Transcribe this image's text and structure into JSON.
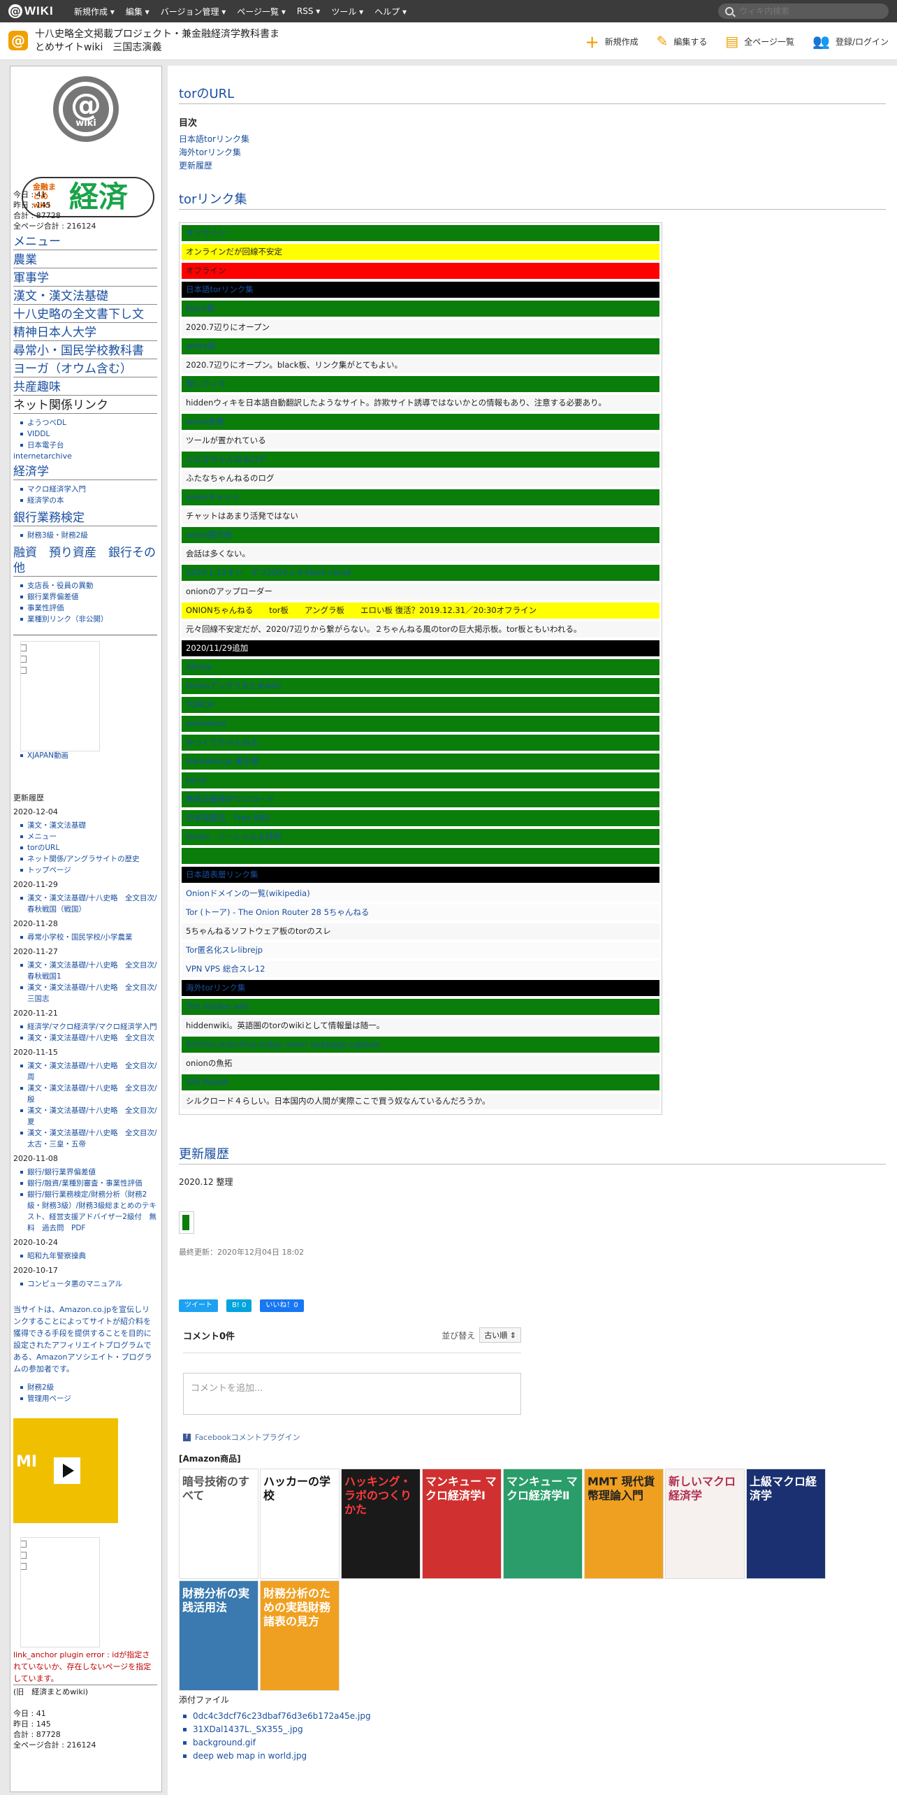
{
  "topbar": {
    "logo": "WIKI",
    "menus": [
      "新規作成 ▾",
      "編集 ▾",
      "バージョン管理 ▾",
      "ページ一覧 ▾",
      "RSS ▾",
      "ツール ▾",
      "ヘルプ ▾"
    ],
    "search_placeholder": "ウィキ内検索"
  },
  "header": {
    "site_title": "十八史略全文掲載プロジェクト・兼金融経済学教科書まとめサイトwiki　三国志演義",
    "actions": [
      "新規作成",
      "編集する",
      "全ページ一覧",
      "登録/ログイン"
    ]
  },
  "sidebar": {
    "badge_text": "wiki",
    "banner_small": "金融まとめwiki",
    "banner_big": "経済",
    "counters": [
      "今日 : 41",
      "昨日 : 145",
      "合計 : 87728",
      "全ページ合計 : 216124"
    ],
    "menu": "メニュー",
    "nav1": [
      "農業",
      "軍事学",
      "漢文・漢文法基礎",
      "十八史略の全文書下し文",
      "精神日本人大学",
      "尋常小・国民学校教科書",
      "ヨーガ（オウム含む）",
      "共産趣味"
    ],
    "net_heading": "ネット関係リンク",
    "net_links": [
      "ようつべDL",
      "VIDDL",
      "日本電子台"
    ],
    "internetarchive": "internetarchive",
    "econ_heading": "経済学",
    "econ_links": [
      "マクロ経済学入門",
      "経済学の本"
    ],
    "bank_heading": "銀行業務検定",
    "bank_links": [
      "財務3級・財務2級"
    ],
    "finance_heading": "融資　預り資産　銀行その他",
    "finance_links": [
      "支店長・役員の異動",
      "銀行業界偏差値",
      "事業性評価",
      "業種別リンク（非公開）"
    ],
    "misc_links": [
      "",
      "",
      "",
      "XJAPAN動画"
    ],
    "updates_title": "更新履歴",
    "updates": [
      {
        "date": "2020-12-04",
        "items": [
          "漢文・漢文法基礎",
          "メニュー",
          "torのURL",
          "ネット関係/アングラサイトの歴史",
          "トップページ"
        ]
      },
      {
        "date": "2020-11-29",
        "items": [
          "漢文・漢文法基礎/十八史略　全文目次/春秋戦国（戦国）"
        ]
      },
      {
        "date": "2020-11-28",
        "items": [
          "尋常小学校・国民学校/小学農業"
        ]
      },
      {
        "date": "2020-11-27",
        "items": [
          "漢文・漢文法基礎/十八史略　全文目次/春秋戦国1",
          "漢文・漢文法基礎/十八史略　全文目次/三国志"
        ]
      },
      {
        "date": "2020-11-21",
        "items": [
          "経済学/マクロ経済学/マクロ経済学入門",
          "漢文・漢文法基礎/十八史略　全文目次"
        ]
      },
      {
        "date": "2020-11-15",
        "items": [
          "漢文・漢文法基礎/十八史略　全文目次/周",
          "漢文・漢文法基礎/十八史略　全文目次/殷",
          "漢文・漢文法基礎/十八史略　全文目次/夏",
          "漢文・漢文法基礎/十八史略　全文目次/太古・三皇・五帝"
        ]
      },
      {
        "date": "2020-11-08",
        "items": [
          "銀行/銀行業界偏差値",
          "銀行/融資/業種別審査・事業性評価",
          "銀行/銀行業務検定/財務分析（財務2級・財務3級）/財務3級総まとめのテキスト、経営支援アドバイザー2級付　無料　過去問　PDF"
        ]
      },
      {
        "date": "2020-10-24",
        "items": [
          "昭和九年警察操典"
        ]
      },
      {
        "date": "2020-10-17",
        "items": [
          "コンピュータ悪のマニュアル"
        ]
      }
    ],
    "amazon_note": "当サイトは、Amazon.co.jpを宣伝しリンクすることによってサイトが紹介料を獲得できる手段を提供することを目的に設定されたアフィリエイトプログラムである、Amazonアソシエイト・プログラムの参加者です。",
    "admin_links": [
      "財務2級",
      "管理用ページ"
    ],
    "video_label": "MI",
    "bottom_links": [
      "",
      "",
      ""
    ],
    "error_text": "link_anchor plugin error : idが指定されていないか、存在しないページを指定しています。",
    "old_name": "(旧　経済まとめwiki)",
    "counters2": [
      "今日 : 41",
      "昨日 : 145",
      "合計 : 87728",
      "全ページ合計 : 216124"
    ]
  },
  "main": {
    "page_title": "torのURL",
    "toc_title": "目次",
    "toc": [
      "日本語torリンク集",
      "海外torリンク集",
      "更新履歴"
    ],
    "section_links": "torリンク集",
    "rows": [
      {
        "cls": "online",
        "text": "オンライン"
      },
      {
        "cls": "unstable",
        "text": "オンラインだが回線不安定"
      },
      {
        "cls": "offline",
        "text": "オフライン"
      },
      {
        "cls": "black lnk",
        "text": "日本語torリンク集"
      },
      {
        "cls": "online",
        "text": "black板"
      },
      {
        "cls": "desc",
        "text": "2020.7辺りにオープン"
      },
      {
        "cls": "online",
        "text": "white板"
      },
      {
        "cls": "desc",
        "text": "2020.7辺りにオープン。black板、リンク集がとてもよい。"
      },
      {
        "cls": "online",
        "text": "隠しウィキ"
      },
      {
        "cls": "desc",
        "text": "hiddenウィキを日本語自動翻訳したようなサイト。詐欺サイト誘導ではないかとの情報もあり、注意する必要あり。"
      },
      {
        "cls": "online",
        "text": "onion倉庫"
      },
      {
        "cls": "desc",
        "text": "ツールが置かれている"
      },
      {
        "cls": "online",
        "text": "ふたなちゃんねるログ"
      },
      {
        "cls": "desc",
        "text": "ふたなちゃんねるのログ"
      },
      {
        "cls": "online",
        "text": "onionチャット"
      },
      {
        "cls": "desc",
        "text": "チャットはあまり活発ではない"
      },
      {
        "cls": "online",
        "text": "onion掲示板"
      },
      {
        "cls": "desc",
        "text": "会話は多くない。"
      },
      {
        "cls": "online",
        "text": "2020.1.12オン　オフ2020.1.4 black cloud"
      },
      {
        "cls": "desc",
        "text": "onionのアップローダー"
      },
      {
        "cls": "unstable",
        "text": "ONIONちゃんねる　　tor板　　アングラ板　　エロい板 復活？2019.12.31／20:30オフライン"
      },
      {
        "cls": "desc",
        "text": "元々回線不安定だが、2020/7辺りから繋がらない。２ちゃんねる風のtorの巨大掲示板。tor板ともいわれる。"
      },
      {
        "cls": "black",
        "text": "2020/11/29追加"
      },
      {
        "cls": "online",
        "text": "Ahmia"
      },
      {
        "cls": "online",
        "text": "Onionアングラまとめwiki"
      },
      {
        "cls": "online",
        "text": "TORCH"
      },
      {
        "cls": "online",
        "text": "onionland"
      },
      {
        "cls": "online",
        "text": "ゆっくりちゃんねる"
      },
      {
        "cls": "online",
        "text": "DarkWeb.jp 掲示板"
      },
      {
        "cls": "online",
        "text": "torch"
      },
      {
        "cls": "online",
        "text": "無修正動画ダウンロード"
      },
      {
        "cls": "online",
        "text": "日本語匿名　Free BBS"
      },
      {
        "cls": "online",
        "text": "Onion　ソーシャル＆評判"
      },
      {
        "cls": "empty",
        "text": ""
      },
      {
        "cls": "black lnk",
        "text": "日本語表層リンク集"
      },
      {
        "cls": "plain",
        "text": "Onionドメインの一覧(wikipedia)"
      },
      {
        "cls": "plain",
        "text": "Tor (トーア) - The Onion Router 28 5ちゃんねる"
      },
      {
        "cls": "desc",
        "text": "5ちゃんねるソフトウェア板のtorのスレ"
      },
      {
        "cls": "plain",
        "text": "Tor匿名化スレlibrejp"
      },
      {
        "cls": "plain",
        "text": "VPN VPS 総合スレ12"
      },
      {
        "cls": "black lnk",
        "text": "海外torリンク集"
      },
      {
        "cls": "online",
        "text": "The hidden wiki"
      },
      {
        "cls": "desc",
        "text": "hiddenwiki。英語圏のtorのwikiとして情報量は随一。"
      },
      {
        "cls": "online",
        "text": "Archive.is/archive.today onion webpage capture"
      },
      {
        "cls": "desc",
        "text": "onionの魚拓"
      },
      {
        "cls": "online",
        "text": "Silk Road4"
      },
      {
        "cls": "desc",
        "text": "シルクロード４らしい。日本国内の人間が実際ここで買う奴なんているんだろうか。"
      }
    ],
    "section_history": "更新履歴",
    "history_text": "2020.12 整理",
    "last_updated": "最終更新：2020年12月04日 18:02",
    "share": [
      "ツイート",
      "B! 0",
      "いいね！0"
    ],
    "comment_count": "コメント0件",
    "sort_label": "並び替え",
    "sort_value": "古い順 ⇕",
    "comment_placeholder": "コメントを追加...",
    "fb_plugin": "Facebookコメントプラグイン",
    "amazon_title": "[Amazon商品]",
    "books": [
      {
        "title": "暗号技術のすべて",
        "bg": "#ffffff",
        "fg": "#555555"
      },
      {
        "title": "ハッカーの学校",
        "bg": "#ffffff",
        "fg": "#111111"
      },
      {
        "title": "ハッキング・ラボのつくりかた",
        "bg": "#1a1a1a",
        "fg": "#ff3b3b"
      },
      {
        "title": "マンキュー マクロ経済学Ⅰ",
        "bg": "#d03030",
        "fg": "#ffffff"
      },
      {
        "title": "マンキュー マクロ経済学Ⅱ",
        "bg": "#2a9d6a",
        "fg": "#ffffff"
      },
      {
        "title": "MMT 現代貨幣理論入門",
        "bg": "#f0a020",
        "fg": "#222222"
      },
      {
        "title": "新しいマクロ経済学",
        "bg": "#f6f0ee",
        "fg": "#b03050"
      },
      {
        "title": "上級マクロ経済学",
        "bg": "#1a3070",
        "fg": "#ffffff"
      },
      {
        "title": "財務分析の実践活用法",
        "bg": "#3a7ab0",
        "fg": "#ffffff"
      },
      {
        "title": "財務分析のための実践財務諸表の見方",
        "bg": "#f0a020",
        "fg": "#ffffff"
      }
    ],
    "attach_title": "添付ファイル",
    "attachments": [
      "0dc4c3dcf76c23dbaf76d3e6b172a45e.jpg",
      "31XDal1437L._SX355_.jpg",
      "background.gif",
      "deep web map in world.jpg"
    ]
  }
}
